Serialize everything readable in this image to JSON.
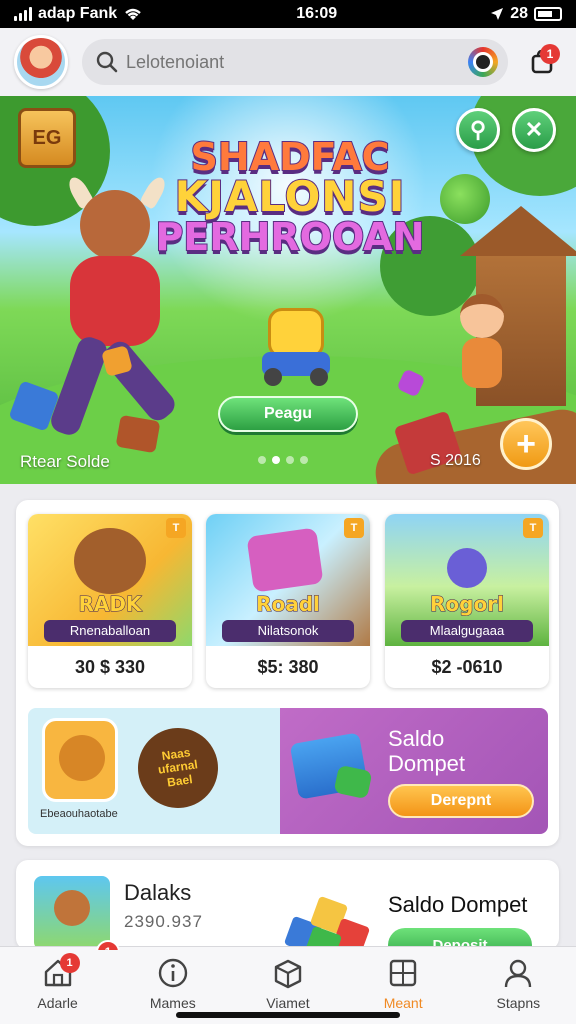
{
  "status_bar": {
    "carrier": "adap Fank",
    "time": "16:09",
    "battery_text": "28"
  },
  "header": {
    "search_placeholder": "Lelotenoiant",
    "notification_count": "1"
  },
  "banner": {
    "badge_text": "EG",
    "title_lines": [
      "SHADFAC",
      "KJALONSI",
      "PERHROOAN"
    ],
    "play_button": "Peagu",
    "left_caption": "Rtear Solde",
    "right_caption": "S 2016",
    "right_btn_green_1": "⚲",
    "right_btn_green_2": "✕"
  },
  "games": [
    {
      "name": "RADK",
      "subtitle": "Rnenaballoan",
      "price": "30 $ 330",
      "corner": "T"
    },
    {
      "name": "Roadl",
      "subtitle": "Nilatsonok",
      "price": "$5: 380",
      "corner": "T"
    },
    {
      "name": "Rogorl",
      "subtitle": "Mlaalgugaaa",
      "price": "$2 -0610",
      "corner": "T"
    }
  ],
  "promo": {
    "sticker_lines": [
      "Naas",
      "ufarnal",
      "Bael"
    ],
    "caption": "Ebeaouhaotabe",
    "title_line1": "Saldo",
    "title_line2": "Dompet",
    "button": "Derepnt"
  },
  "bottom_card": {
    "title": "Dalaks",
    "subtitle": "2390.937",
    "badge": "1",
    "right_title": "Saldo Dompet",
    "button": "Deposit"
  },
  "tabs": [
    {
      "label": "Adarle",
      "icon": "home-icon",
      "active": false,
      "badge": "1"
    },
    {
      "label": "Mames",
      "icon": "info-icon",
      "active": false
    },
    {
      "label": "Viamet",
      "icon": "box-icon",
      "active": false
    },
    {
      "label": "Meant",
      "icon": "grid-icon",
      "active": true
    },
    {
      "label": "Stapns",
      "icon": "user-icon",
      "active": false
    }
  ],
  "colors": {
    "accent": "#f08a24",
    "green": "#2da043",
    "purple": "#a355b6"
  }
}
